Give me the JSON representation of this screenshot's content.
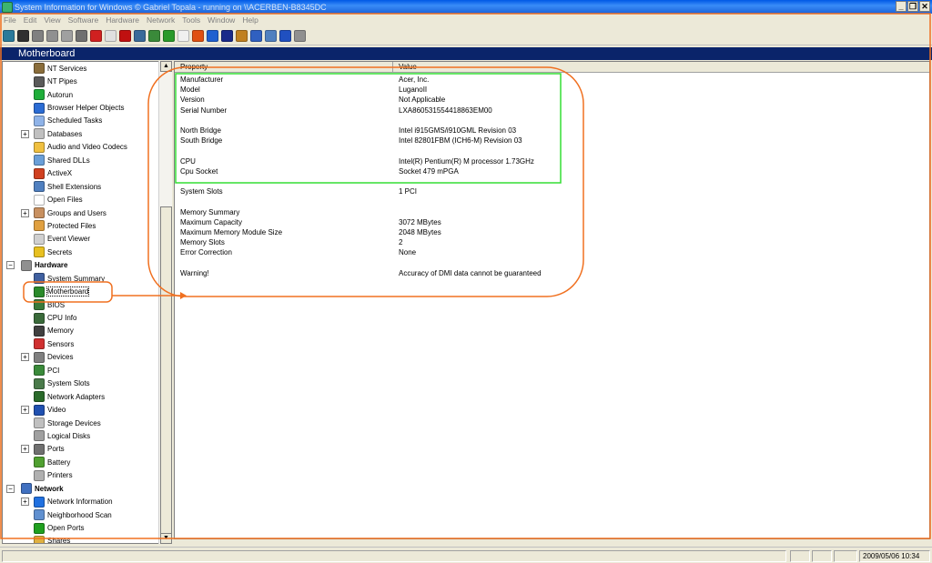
{
  "window": {
    "title": "System Information for Windows  © Gabriel Topala - running on \\\\ACERBEN-B8345DC"
  },
  "menu": [
    "File",
    "Edit",
    "View",
    "Software",
    "Hardware",
    "Network",
    "Tools",
    "Window",
    "Help"
  ],
  "toolbar_icons": [
    "exit-icon",
    "save-icon",
    "cut-icon",
    "copy-icon",
    "paste-icon",
    "print-icon",
    "stop-icon",
    "chat-icon",
    "flag-icon",
    "chart-icon",
    "globe-icon",
    "refresh-icon",
    "report-icon",
    "office-icon",
    "back-icon",
    "shield-icon",
    "book-icon",
    "ie-icon",
    "window-icon",
    "help-icon",
    "about-icon"
  ],
  "page_header": "Motherboard",
  "tree": [
    {
      "label": "NT Services",
      "icon": "gear-icon",
      "color": "#8a6d3b",
      "level": 2
    },
    {
      "label": "NT Pipes",
      "icon": "pipe-icon",
      "color": "#5a5a5a",
      "level": 2
    },
    {
      "label": "Autorun",
      "icon": "autorun-icon",
      "color": "#1fae3a",
      "level": 2
    },
    {
      "label": "Browser Helper Objects",
      "icon": "ie-icon",
      "color": "#2b6cd4",
      "level": 2
    },
    {
      "label": "Scheduled Tasks",
      "icon": "tasks-icon",
      "color": "#8fb3e8",
      "level": 2
    },
    {
      "label": "Databases",
      "icon": "database-icon",
      "color": "#c0c0c0",
      "level": 2,
      "expander": "+"
    },
    {
      "label": "Audio and Video Codecs",
      "icon": "codec-icon",
      "color": "#f0c040",
      "level": 2
    },
    {
      "label": "Shared DLLs",
      "icon": "dll-icon",
      "color": "#6a9fd8",
      "level": 2
    },
    {
      "label": "ActiveX",
      "icon": "activex-icon",
      "color": "#d04020",
      "level": 2
    },
    {
      "label": "Shell Extensions",
      "icon": "shell-icon",
      "color": "#5080c0",
      "level": 2
    },
    {
      "label": "Open Files",
      "icon": "file-icon",
      "color": "#ffffff",
      "level": 2
    },
    {
      "label": "Groups and Users",
      "icon": "users-icon",
      "color": "#c89060",
      "level": 2,
      "expander": "+"
    },
    {
      "label": "Protected Files",
      "icon": "protected-file-icon",
      "color": "#e0a040",
      "level": 2
    },
    {
      "label": "Event Viewer",
      "icon": "event-viewer-icon",
      "color": "#d0d0d0",
      "level": 2
    },
    {
      "label": "Secrets",
      "icon": "key-icon",
      "color": "#e8c020",
      "level": 2
    },
    {
      "label": "Hardware",
      "icon": "hardware-icon",
      "color": "#909090",
      "level": 1,
      "expander": "-",
      "category": true
    },
    {
      "label": "System Summary",
      "icon": "summary-icon",
      "color": "#4060a0",
      "level": 2
    },
    {
      "label": "Motherboard",
      "icon": "motherboard-icon",
      "color": "#2a8a2a",
      "level": 2,
      "selected": true
    },
    {
      "label": "BIOS",
      "icon": "bios-icon",
      "color": "#3a7a3a",
      "level": 2
    },
    {
      "label": "CPU Info",
      "icon": "cpu-icon",
      "color": "#3a6a3a",
      "level": 2
    },
    {
      "label": "Memory",
      "icon": "memory-icon",
      "color": "#404040",
      "level": 2
    },
    {
      "label": "Sensors",
      "icon": "sensor-icon",
      "color": "#d03030",
      "level": 2
    },
    {
      "label": "Devices",
      "icon": "devices-icon",
      "color": "#808080",
      "level": 2,
      "expander": "+"
    },
    {
      "label": "PCI",
      "icon": "pci-icon",
      "color": "#3a8a3a",
      "level": 2
    },
    {
      "label": "System Slots",
      "icon": "slots-icon",
      "color": "#4a7a4a",
      "level": 2
    },
    {
      "label": "Network Adapters",
      "icon": "network-adapter-icon",
      "color": "#2a6a2a",
      "level": 2
    },
    {
      "label": "Video",
      "icon": "video-icon",
      "color": "#2050b0",
      "level": 2,
      "expander": "+"
    },
    {
      "label": "Storage Devices",
      "icon": "storage-icon",
      "color": "#c0c0c0",
      "level": 2
    },
    {
      "label": "Logical Disks",
      "icon": "disk-icon",
      "color": "#a0a0a0",
      "level": 2
    },
    {
      "label": "Ports",
      "icon": "port-icon",
      "color": "#707070",
      "level": 2,
      "expander": "+"
    },
    {
      "label": "Battery",
      "icon": "battery-icon",
      "color": "#50a030",
      "level": 2
    },
    {
      "label": "Printers",
      "icon": "printer-icon",
      "color": "#b0b0b0",
      "level": 2
    },
    {
      "label": "Network",
      "icon": "network-icon",
      "color": "#4070c0",
      "level": 1,
      "expander": "-",
      "category": true
    },
    {
      "label": "Network Information",
      "icon": "info-icon",
      "color": "#2070e0",
      "level": 2,
      "expander": "+"
    },
    {
      "label": "Neighborhood Scan",
      "icon": "scan-icon",
      "color": "#6090d0",
      "level": 2
    },
    {
      "label": "Open Ports",
      "icon": "open-ports-icon",
      "color": "#20a020",
      "level": 2
    },
    {
      "label": "Shares",
      "icon": "shares-icon",
      "color": "#e0b040",
      "level": 2
    }
  ],
  "table": {
    "headers": [
      "Property",
      "Value"
    ],
    "rows": [
      {
        "p": "Manufacturer",
        "v": "Acer, Inc."
      },
      {
        "p": "Model",
        "v": "LuganoII"
      },
      {
        "p": "Version",
        "v": "Not Applicable"
      },
      {
        "p": "Serial Number",
        "v": "LXA860531554418863EM00"
      },
      {
        "p": "",
        "v": ""
      },
      {
        "p": "North Bridge",
        "v": "Intel i915GMS/i910GML Revision 03"
      },
      {
        "p": "South Bridge",
        "v": "Intel 82801FBM (ICH6-M) Revision 03"
      },
      {
        "p": "",
        "v": ""
      },
      {
        "p": "CPU",
        "v": "Intel(R) Pentium(R) M processor 1.73GHz"
      },
      {
        "p": "Cpu Socket",
        "v": "Socket 479 mPGA"
      },
      {
        "p": "",
        "v": ""
      },
      {
        "p": "System Slots",
        "v": "1 PCI"
      },
      {
        "p": "",
        "v": ""
      },
      {
        "p": "Memory Summary",
        "v": ""
      },
      {
        "p": "Maximum Capacity",
        "v": "3072 MBytes"
      },
      {
        "p": "Maximum Memory Module Size",
        "v": "2048 MBytes"
      },
      {
        "p": "Memory Slots",
        "v": "2"
      },
      {
        "p": "Error Correction",
        "v": "None"
      },
      {
        "p": "",
        "v": ""
      },
      {
        "p": "Warning!",
        "v": "Accuracy of DMI data cannot be guaranteed"
      }
    ]
  },
  "status": {
    "datetime": "2009/05/06 10:34"
  },
  "colors": {
    "highlight_green": "#33dd33",
    "highlight_orange": "#f07020",
    "header_blue": "#0a246a"
  }
}
